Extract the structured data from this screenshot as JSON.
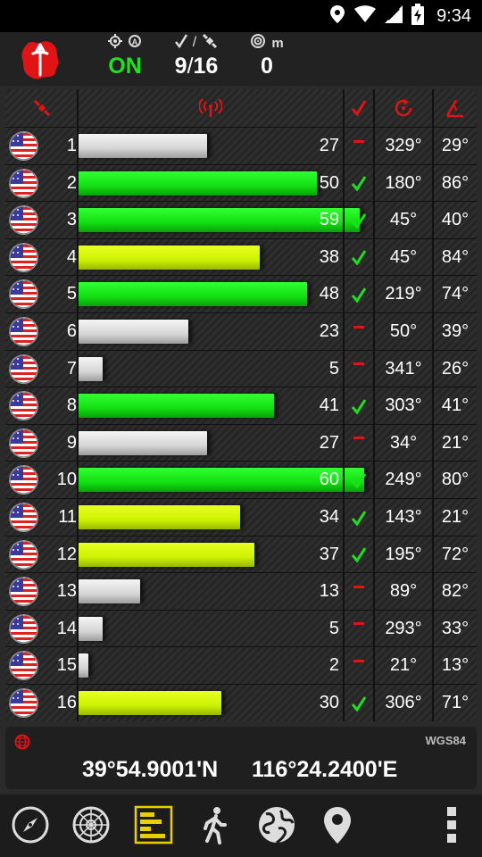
{
  "statusbar": {
    "time": "9:34"
  },
  "header": {
    "fix_status": "ON",
    "used_count": "9",
    "separator": "/",
    "visible_count": "16",
    "accuracy_value": "0",
    "accuracy_unit": "m"
  },
  "satellites": [
    {
      "prn": "1",
      "snr": "27",
      "snr_level": 27,
      "used": false,
      "azimuth": "329°",
      "elevation": "29°",
      "color": "gray"
    },
    {
      "prn": "2",
      "snr": "50",
      "snr_level": 50,
      "used": true,
      "azimuth": "180°",
      "elevation": "86°",
      "color": "green"
    },
    {
      "prn": "3",
      "snr": "59",
      "snr_level": 59,
      "used": true,
      "azimuth": "45°",
      "elevation": "40°",
      "color": "green"
    },
    {
      "prn": "4",
      "snr": "38",
      "snr_level": 38,
      "used": true,
      "azimuth": "45°",
      "elevation": "84°",
      "color": "lime"
    },
    {
      "prn": "5",
      "snr": "48",
      "snr_level": 48,
      "used": true,
      "azimuth": "219°",
      "elevation": "74°",
      "color": "green"
    },
    {
      "prn": "6",
      "snr": "23",
      "snr_level": 23,
      "used": false,
      "azimuth": "50°",
      "elevation": "39°",
      "color": "gray"
    },
    {
      "prn": "7",
      "snr": "5",
      "snr_level": 5,
      "used": false,
      "azimuth": "341°",
      "elevation": "26°",
      "color": "gray"
    },
    {
      "prn": "8",
      "snr": "41",
      "snr_level": 41,
      "used": true,
      "azimuth": "303°",
      "elevation": "41°",
      "color": "green"
    },
    {
      "prn": "9",
      "snr": "27",
      "snr_level": 27,
      "used": false,
      "azimuth": "34°",
      "elevation": "21°",
      "color": "gray"
    },
    {
      "prn": "10",
      "snr": "60",
      "snr_level": 60,
      "used": true,
      "azimuth": "249°",
      "elevation": "80°",
      "color": "green"
    },
    {
      "prn": "11",
      "snr": "34",
      "snr_level": 34,
      "used": true,
      "azimuth": "143°",
      "elevation": "21°",
      "color": "lime"
    },
    {
      "prn": "12",
      "snr": "37",
      "snr_level": 37,
      "used": true,
      "azimuth": "195°",
      "elevation": "72°",
      "color": "lime"
    },
    {
      "prn": "13",
      "snr": "13",
      "snr_level": 13,
      "used": false,
      "azimuth": "89°",
      "elevation": "82°",
      "color": "gray"
    },
    {
      "prn": "14",
      "snr": "5",
      "snr_level": 5,
      "used": false,
      "azimuth": "293°",
      "elevation": "33°",
      "color": "gray"
    },
    {
      "prn": "15",
      "snr": "2",
      "snr_level": 2,
      "used": false,
      "azimuth": "21°",
      "elevation": "13°",
      "color": "gray"
    },
    {
      "prn": "16",
      "snr": "30",
      "snr_level": 30,
      "used": true,
      "azimuth": "306°",
      "elevation": "71°",
      "color": "lime"
    }
  ],
  "coordinates": {
    "datum": "WGS84",
    "latitude": "39°54.9001'N",
    "longitude": "116°24.2400'E"
  },
  "nav": {
    "items": [
      "compass-icon",
      "radar-icon",
      "satellite-bars-icon",
      "walk-icon",
      "globe-icon",
      "location-pin-icon",
      "more-icon"
    ],
    "active": "satellite-bars-icon"
  },
  "colors": {
    "accent_red": "#e01414",
    "fix_green": "#22e022",
    "bar_green": "#12e012",
    "bar_lime": "#ccf200",
    "bar_gray": "#d6d6d6",
    "check_green": "#1ee01e",
    "nav_active": "#e8d000"
  }
}
